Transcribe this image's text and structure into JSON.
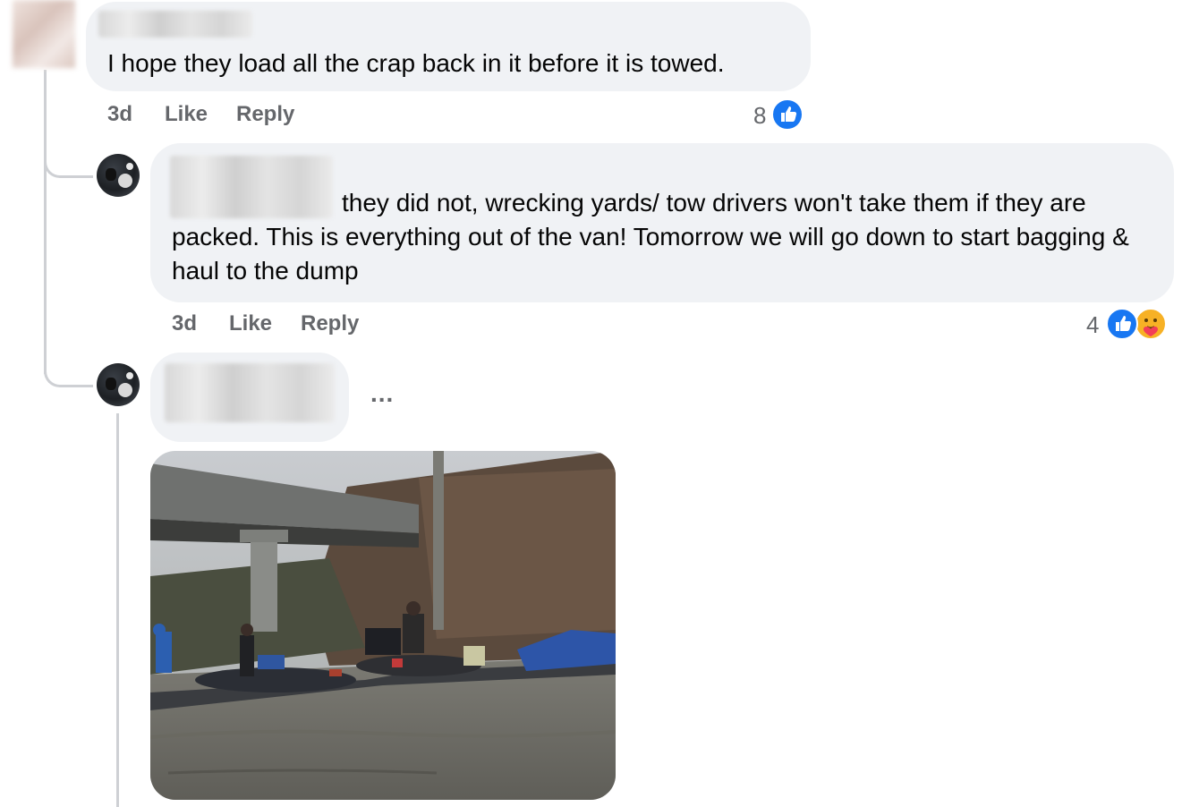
{
  "comments": [
    {
      "author": "",
      "text": "I hope they load all the crap back in it before it is towed.",
      "time": "3d",
      "like_label": "Like",
      "reply_label": "Reply",
      "reaction_count": "8",
      "reactions": [
        "like-icon"
      ]
    },
    {
      "author": "",
      "text": "they did not, wrecking yards/ tow drivers won't take them if they are packed. This is everything out of the van! Tomorrow we will go down to start bagging & haul to the dump",
      "time": "3d",
      "like_label": "Like",
      "reply_label": "Reply",
      "reaction_count": "4",
      "reactions": [
        "like-icon",
        "care-icon"
      ]
    },
    {
      "author": "",
      "more_label": "...",
      "attachment": "photo"
    }
  ],
  "colors": {
    "bubble": "#f0f2f5",
    "meta_text": "#65676b",
    "like_blue": "#1877f2",
    "care_yellow": "#f7b125",
    "thread_line": "#ced0d4"
  }
}
